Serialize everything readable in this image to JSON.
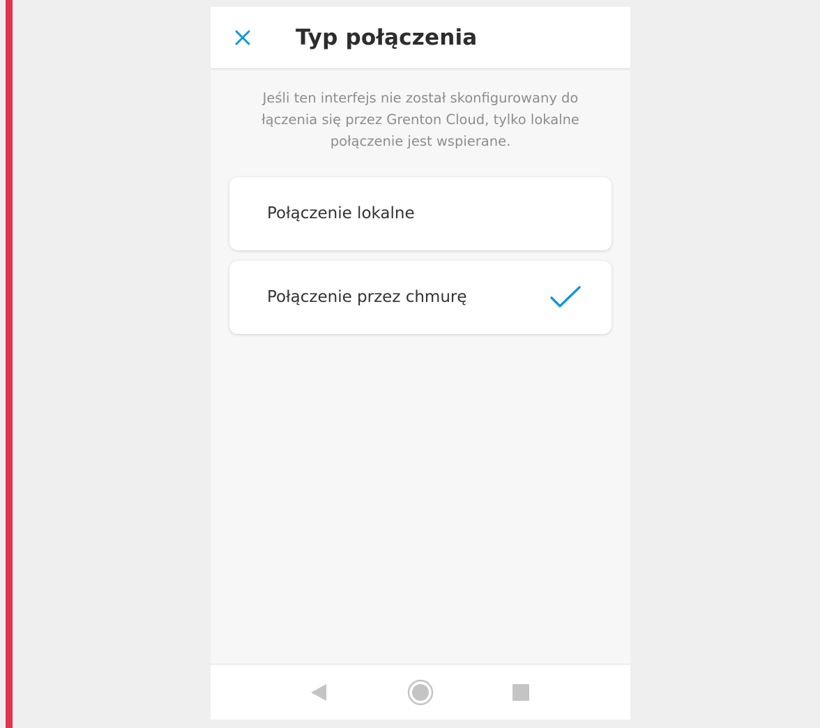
{
  "colors": {
    "accent": "#1596d8",
    "left_strip": "#e0344f",
    "nav_icon": "#c4c4c4"
  },
  "header": {
    "close_icon": "close-icon",
    "title": "Typ połączenia"
  },
  "info": {
    "text": "Jeśli ten interfejs nie został skonfigurowany do łączenia się przez Grenton Cloud, tylko lokalne połączenie jest wspierane."
  },
  "options": [
    {
      "label": "Połączenie lokalne",
      "selected": false
    },
    {
      "label": "Połączenie przez chmurę",
      "selected": true,
      "icon": "checkmark-icon"
    }
  ],
  "navigation": {
    "back_icon": "back-triangle-icon",
    "home_icon": "home-circle-icon",
    "recents_icon": "recents-square-icon"
  }
}
